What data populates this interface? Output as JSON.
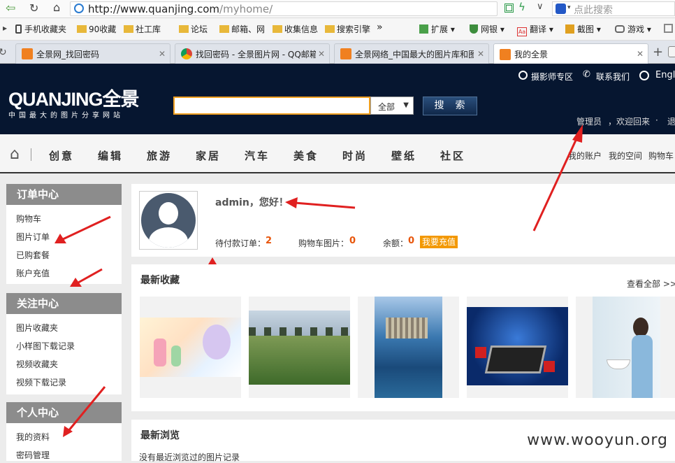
{
  "browser": {
    "url_host": "http://www.quanjing.com",
    "url_path": "/myhome/",
    "search_placeholder": "点此搜索"
  },
  "bookmarks": [
    "手机收藏夹",
    "90收藏",
    "社工库",
    "论坛",
    "邮箱、网",
    "收集信息",
    "搜索引擎"
  ],
  "bookmarks_more": "»",
  "toolbar": [
    "扩展",
    "网银",
    "翻译",
    "截图",
    "游戏"
  ],
  "tabs": [
    "全景网_找回密码",
    "找回密码 - 全景图片网 - QQ邮箱",
    "全景网络_中国最大的图片库和图",
    "我的全景"
  ],
  "header": {
    "logo_main": "QUANJING全景",
    "logo_sub": "中国最大的图片分享网站",
    "search_scope": "全部",
    "search_button": "搜　索",
    "top_links": [
      "摄影师专区",
      "联系我们",
      "Engl"
    ],
    "user_name": "管理员",
    "welcome": "，欢迎回来",
    "dot": "·",
    "logout": "退"
  },
  "nav": {
    "items": [
      "创意",
      "编辑",
      "旅游",
      "家居",
      "汽车",
      "美食",
      "时尚",
      "壁纸",
      "社区"
    ],
    "right": [
      "我的账户",
      "我的空间",
      "购物车"
    ]
  },
  "sidebar": {
    "order_center": {
      "title": "订单中心",
      "links": [
        "购物车",
        "图片订单",
        "已购套餐",
        "账户充值"
      ]
    },
    "follow_center": {
      "title": "关注中心",
      "links": [
        "图片收藏夹",
        "小样图下载记录",
        "视频收藏夹",
        "视频下载记录"
      ]
    },
    "personal_center": {
      "title": "个人中心",
      "links": [
        "我的资料",
        "密码管理"
      ]
    }
  },
  "profile": {
    "greeting": "admin，您好！",
    "pending_label": "待付款订单：",
    "pending_value": "2",
    "cart_label": "购物车图片：",
    "cart_value": "0",
    "balance_label": "余额：",
    "balance_value": "0",
    "recharge_button": "我要充值"
  },
  "favorites": {
    "title": "最新收藏",
    "view_all": "查看全部 >>"
  },
  "recent": {
    "title": "最新浏览",
    "empty": "没有最近浏览过的图片记录"
  },
  "watermark": "www.wooyun.org",
  "colors": {
    "header_bg": "#061630",
    "accent": "#f39800",
    "value_red": "#e8550a",
    "arrow": "#e02020"
  }
}
